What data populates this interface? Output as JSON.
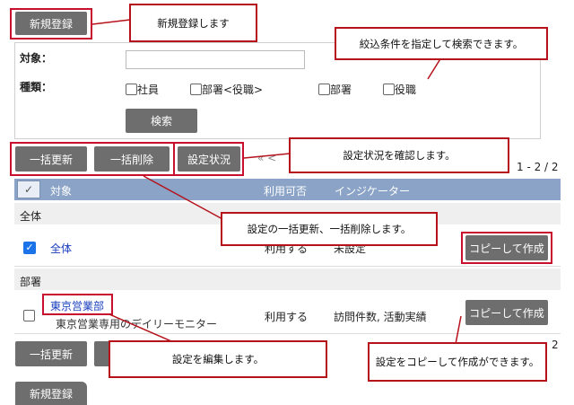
{
  "buttons": {
    "new_register_top": "新規登録",
    "new_register_bottom": "新規登録",
    "search": "検索",
    "bulk_update": "一括更新",
    "bulk_delete": "一括削除",
    "settings_status": "設定状況",
    "copy_create_1": "コピーして作成",
    "copy_create_2": "コピーして作成",
    "bulk_update_bottom": "一括更新"
  },
  "filter": {
    "target_label": "対象：",
    "target_value": "",
    "type_label": "種類：",
    "options": [
      "社員",
      "部署<役職>",
      "部署",
      "役職"
    ]
  },
  "pager": {
    "arrows": "«  <",
    "count": "1 - 2 / 2",
    "count_bottom": "2"
  },
  "table": {
    "headers": {
      "target": "対象",
      "usage": "利用可否",
      "indicator": "インジケーター"
    },
    "groups": [
      {
        "title": "全体",
        "rows": [
          {
            "name": "全体",
            "checked": true,
            "usage": "利用する",
            "indicator": "未設定"
          }
        ]
      },
      {
        "title": "部署",
        "rows": [
          {
            "name": "東京営業部",
            "subtitle": "東京営業専用のデイリーモニター",
            "checked": false,
            "usage": "利用する",
            "indicator": "訪問件数, 活動実績"
          }
        ]
      }
    ]
  },
  "callouts": {
    "new": "新規登録します",
    "filter": "絞込条件を指定して検索できます。",
    "status": "設定状況を確認します。",
    "bulk": "設定の一括更新、一括削除します。",
    "edit": "設定を編集します。",
    "copy": "設定をコピーして作成ができます。"
  }
}
